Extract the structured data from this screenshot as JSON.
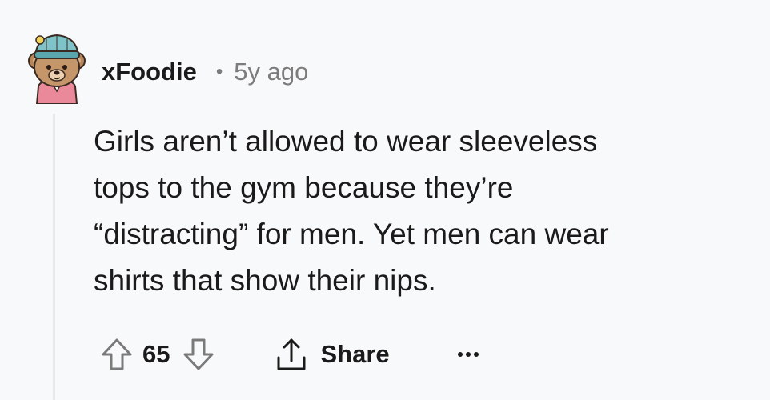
{
  "comment": {
    "author": "xFoodie",
    "separator": "•",
    "timestamp": "5y ago",
    "body_lines": [
      "Girls aren’t allowed to wear sleeveless",
      "tops to the gym because they’re",
      "“distracting” for men. Yet men can wear",
      "shirts that show their nips."
    ],
    "votes": "65",
    "share_label": "Share"
  },
  "icons": {
    "avatar": "bear-avatar-icon",
    "upvote": "arrow-up-icon",
    "downvote": "arrow-down-icon",
    "share": "share-icon",
    "more": "more-dots-icon"
  },
  "colors": {
    "background": "#f8f9fa",
    "text": "#1a1a1b",
    "meta": "#7c7c7c",
    "thread_line": "#e6e8ea",
    "icon_stroke": "#7a7a7a"
  }
}
